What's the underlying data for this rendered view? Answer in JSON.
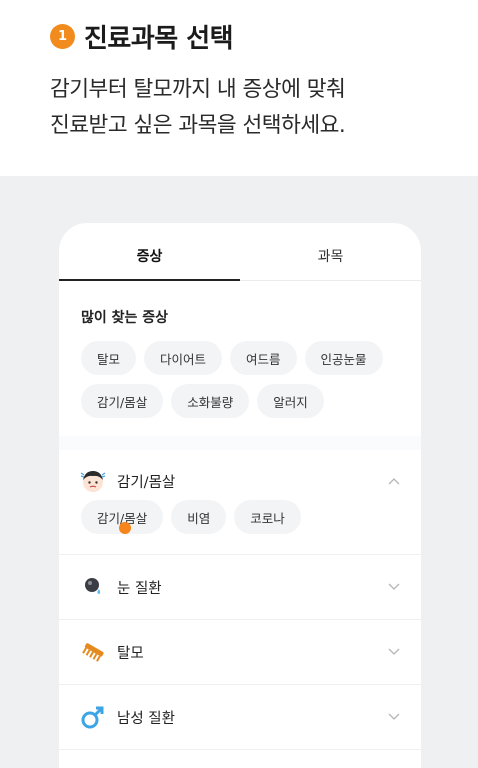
{
  "intro": {
    "step_number": "1",
    "title": "진료과목 선택",
    "desc_line1": "감기부터 탈모까지 내 증상에 맞춰",
    "desc_line2": "진료받고 싶은 과목을 선택하세요."
  },
  "tabs": [
    {
      "label": "증상",
      "active": true
    },
    {
      "label": "과목",
      "active": false
    }
  ],
  "popular": {
    "title": "많이 찾는 증상",
    "chips": [
      "탈모",
      "다이어트",
      "여드름",
      "인공눈물",
      "감기/몸살",
      "소화불량",
      "알러지"
    ]
  },
  "categories": [
    {
      "label": "감기/몸살",
      "icon": "sick-face-icon",
      "expanded": true,
      "sub_chips": [
        "감기/몸살",
        "비염",
        "코로나"
      ]
    },
    {
      "label": "눈 질환",
      "icon": "eye-drop-icon",
      "expanded": false
    },
    {
      "label": "탈모",
      "icon": "comb-icon",
      "expanded": false
    },
    {
      "label": "남성 질환",
      "icon": "male-symbol-icon",
      "expanded": false
    }
  ],
  "colors": {
    "accent": "#f28b1d",
    "stage_bg": "#eef0f2",
    "chip_bg": "#f3f4f6"
  }
}
